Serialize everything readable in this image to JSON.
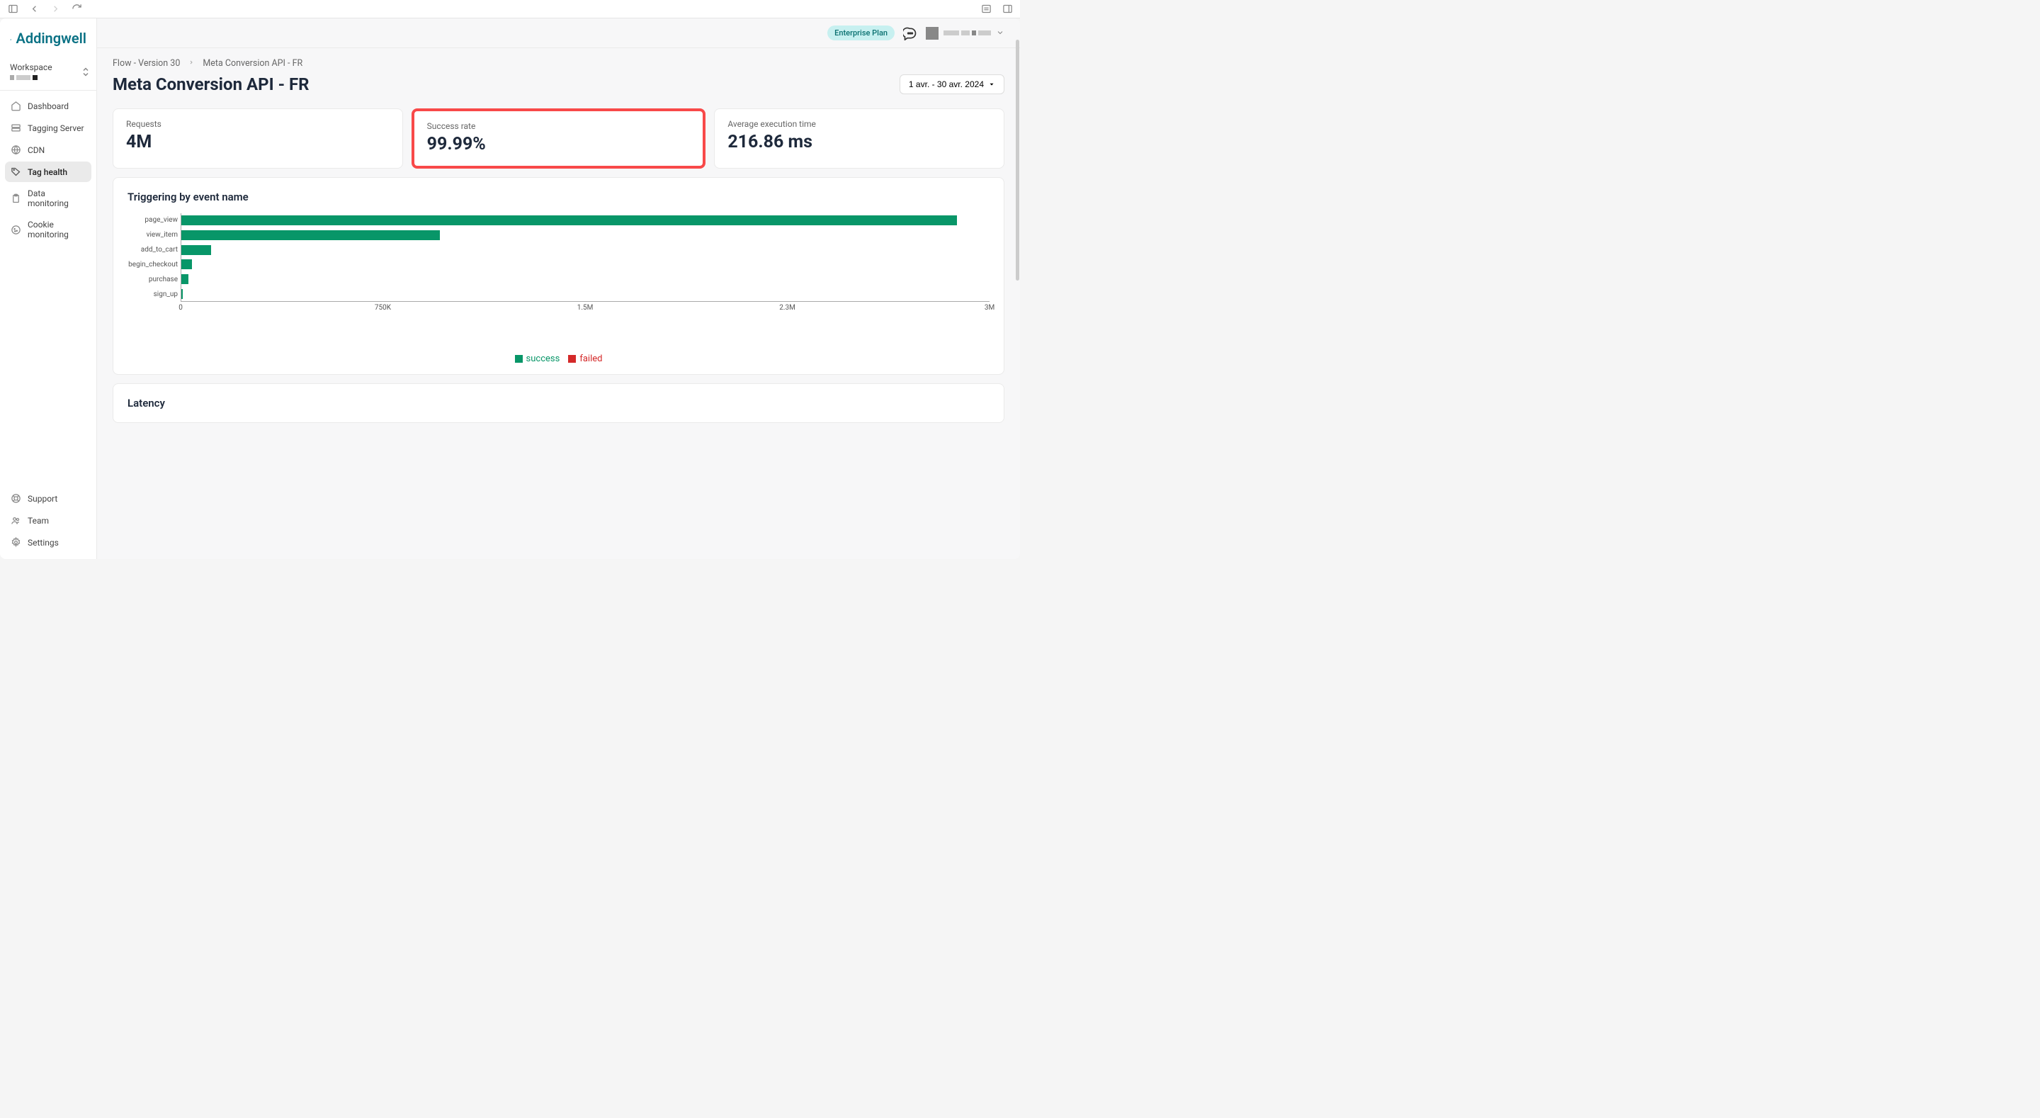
{
  "browser": {
    "icons": [
      "sidebar-left",
      "back",
      "forward",
      "reload",
      "settings-right",
      "sidebar-right"
    ]
  },
  "logo": {
    "text": "Addingwell"
  },
  "workspace": {
    "label": "Workspace"
  },
  "nav": {
    "items": [
      {
        "icon": "home",
        "label": "Dashboard"
      },
      {
        "icon": "server",
        "label": "Tagging Server"
      },
      {
        "icon": "globe",
        "label": "CDN"
      },
      {
        "icon": "tag",
        "label": "Tag health",
        "active": true
      },
      {
        "icon": "clipboard",
        "label": "Data monitoring"
      },
      {
        "icon": "cookie",
        "label": "Cookie monitoring"
      }
    ],
    "bottom": [
      {
        "icon": "life-ring",
        "label": "Support"
      },
      {
        "icon": "users",
        "label": "Team"
      },
      {
        "icon": "gear",
        "label": "Settings"
      }
    ]
  },
  "header": {
    "plan": "Enterprise Plan"
  },
  "breadcrumb": {
    "items": [
      "Flow - Version 30",
      "Meta Conversion API - FR"
    ]
  },
  "page_title": "Meta Conversion API - FR",
  "date_range": "1 avr. - 30 avr. 2024",
  "stats": [
    {
      "label": "Requests",
      "value": "4M"
    },
    {
      "label": "Success rate",
      "value": "99.99%",
      "highlighted": true
    },
    {
      "label": "Average execution time",
      "value": "216.86 ms"
    }
  ],
  "chart_data": {
    "type": "bar",
    "title": "Triggering by event name",
    "orientation": "horizontal",
    "categories": [
      "page_view",
      "view_item",
      "add_to_cart",
      "begin_checkout",
      "purchase",
      "sign_up"
    ],
    "series": [
      {
        "name": "success",
        "color": "#089668",
        "values": [
          2880000,
          960000,
          110000,
          40000,
          25000,
          5000
        ]
      },
      {
        "name": "failed",
        "color": "#d42929",
        "values": [
          0,
          0,
          0,
          0,
          0,
          0
        ]
      }
    ],
    "xlabel": "",
    "ylabel": "",
    "x_ticks": [
      "0",
      "750K",
      "1.5M",
      "2.3M",
      "3M"
    ],
    "xlim": [
      0,
      3000000
    ],
    "legend": [
      "success",
      "failed"
    ]
  },
  "latency_title": "Latency"
}
